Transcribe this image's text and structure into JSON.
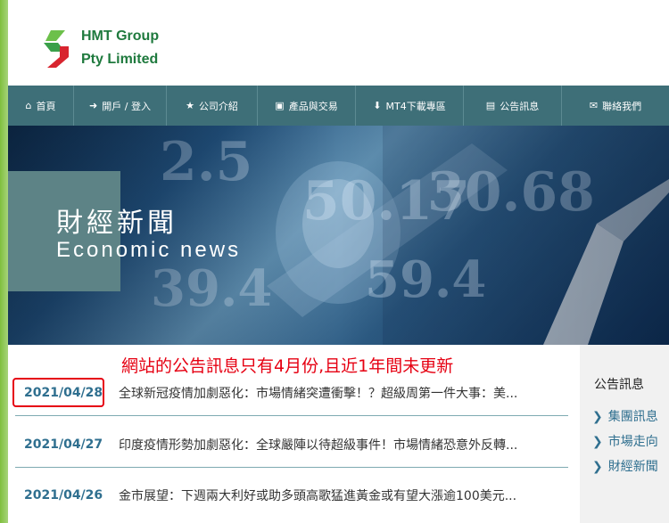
{
  "brand": {
    "line1": "HMT Group",
    "line2": "Pty Limited"
  },
  "nav": [
    {
      "icon": "home-icon",
      "glyph": "⌂",
      "label": "首頁"
    },
    {
      "icon": "login-icon",
      "glyph": "➜",
      "label": "開戶 / 登入"
    },
    {
      "icon": "star-icon",
      "glyph": "★",
      "label": "公司介紹"
    },
    {
      "icon": "briefcase-icon",
      "glyph": "▣",
      "label": "產品與交易"
    },
    {
      "icon": "download-icon",
      "glyph": "⬇",
      "label": "MT4下載專區"
    },
    {
      "icon": "newspaper-icon",
      "glyph": "▤",
      "label": "公告訊息"
    },
    {
      "icon": "envelope-icon",
      "glyph": "✉",
      "label": "聯絡我們"
    }
  ],
  "banner": {
    "title": "財經新聞",
    "subtitle": "Economic news"
  },
  "annotation": "網站的公告訊息只有4月份,且近1年間未更新",
  "news": [
    {
      "date": "2021/04/28",
      "headline": "全球新冠疫情加劇惡化：市場情緒突遭衝擊！？超級周第一件大事：美..."
    },
    {
      "date": "2021/04/27",
      "headline": "印度疫情形勢加劇惡化：全球嚴陣以待超級事件！市場情緒恐意外反轉..."
    },
    {
      "date": "2021/04/26",
      "headline": "金市展望：下週兩大利好或助多頭高歌猛進黃金或有望大漲逾100美元..."
    }
  ],
  "sidebar": {
    "title": "公告訊息",
    "items": [
      {
        "label": "集團訊息"
      },
      {
        "label": "市場走向"
      },
      {
        "label": "財經新聞"
      }
    ]
  },
  "colors": {
    "nav_bg": "#3e6f78",
    "accent_green": "#1f7a3e",
    "link_blue": "#2f6f8f",
    "annotation_red": "#e60012"
  }
}
